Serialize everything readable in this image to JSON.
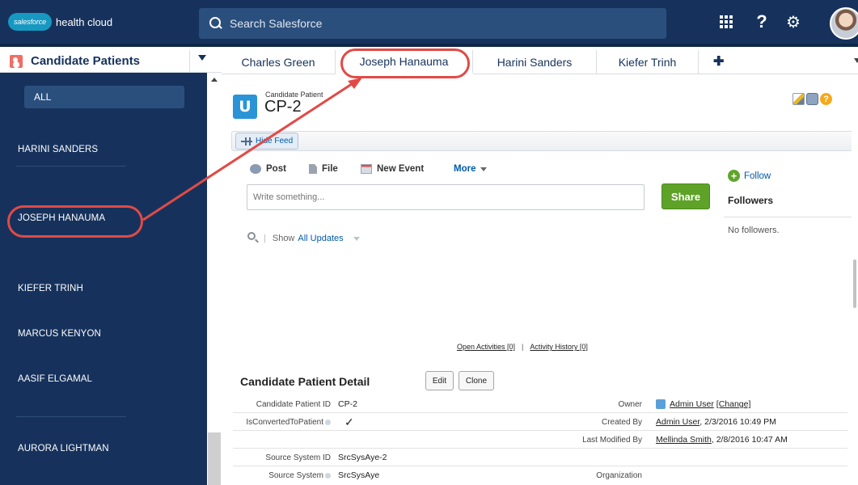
{
  "header": {
    "logo_badge": "salesforce",
    "logo_text": "health cloud",
    "search_placeholder": "Search Salesforce",
    "help_glyph": "?",
    "gear_glyph": "⚙"
  },
  "sidebar": {
    "title": "Candidate Patients",
    "all_label": "ALL",
    "items": [
      {
        "label": "HARINI SANDERS"
      },
      {
        "label": "JOSEPH HANAUMA"
      },
      {
        "label": "KIEFER TRINH"
      },
      {
        "label": "MARCUS KENYON"
      },
      {
        "label": "AASIF ELGAMAL"
      },
      {
        "label": "AURORA LIGHTMAN"
      }
    ]
  },
  "tabs": [
    {
      "label": "Charles Green"
    },
    {
      "label": "Joseph Hanauma",
      "active": true
    },
    {
      "label": "Harini Sanders"
    },
    {
      "label": "Kiefer Trinh"
    }
  ],
  "tab_add_glyph": "✚",
  "record": {
    "type": "Candidate Patient",
    "name": "CP-2",
    "icon_glyph": "ᑌ"
  },
  "feed": {
    "hide_feed_label": "Hide Feed",
    "actions": {
      "post": "Post",
      "file": "File",
      "new_event": "New Event",
      "more": "More"
    },
    "input_placeholder": "Write something...",
    "share_label": "Share",
    "follow_label": "Follow",
    "followers_title": "Followers",
    "no_followers": "No followers.",
    "filter_show": "Show",
    "filter_value": "All Updates"
  },
  "related": {
    "open_activities": "Open Activities [0]",
    "activity_history": "Activity History [0]",
    "separator": "|"
  },
  "detail": {
    "title": "Candidate Patient Detail",
    "edit_label": "Edit",
    "clone_label": "Clone",
    "fields": {
      "candidate_patient_id_label": "Candidate Patient ID",
      "candidate_patient_id_value": "CP-2",
      "owner_label": "Owner",
      "owner_value": "Admin User",
      "owner_change": "[Change]",
      "is_converted_label": "IsConvertedToPatient",
      "is_converted_value": "✓",
      "created_by_label": "Created By",
      "created_by_user": "Admin User",
      "created_by_date": ", 2/3/2016 10:49 PM",
      "last_modified_label": "Last Modified By",
      "last_modified_user": "Mellinda Smith",
      "last_modified_date": ", 2/8/2016 10:47 AM",
      "source_system_id_label": "Source System ID",
      "source_system_id_value": "SrcSysAye-2",
      "source_system_label": "Source System",
      "source_system_value": "SrcSysAye",
      "organization_label": "Organization"
    }
  },
  "colors": {
    "header_bg": "#16325c",
    "sidebar_bg": "#16325c",
    "annotation": "#e24a46",
    "share_green": "#5ea228",
    "link_blue": "#015ba7"
  }
}
